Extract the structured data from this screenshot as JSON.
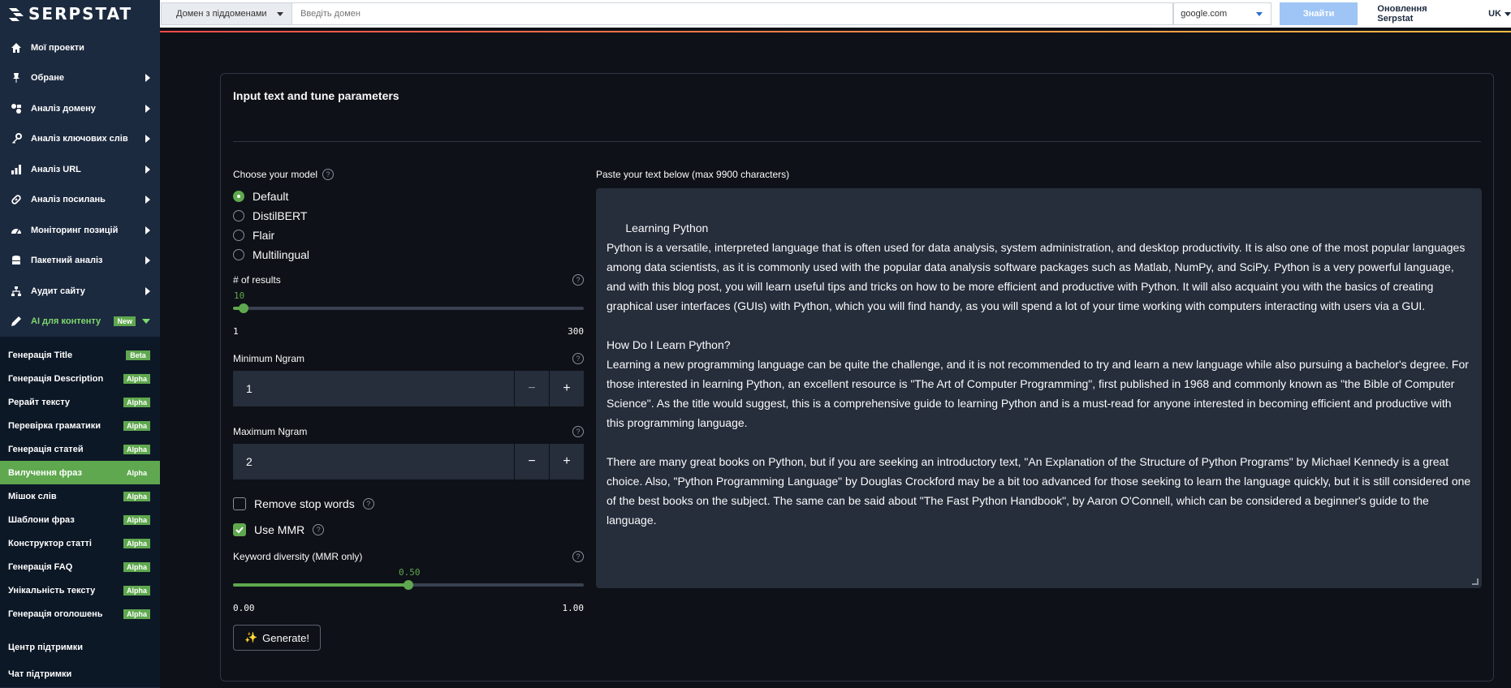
{
  "brand": {
    "logo_text": "SERPSTAT"
  },
  "topbar": {
    "domain_select": "Домен з піддоменами",
    "domain_placeholder": "Введіть домен",
    "database": "google.com",
    "find_button": "Знайти",
    "updates_link": "Оновлення Serpstat",
    "language": "UK"
  },
  "sidebar": {
    "items": [
      {
        "label": "Мої проекти",
        "icon": "home-icon"
      },
      {
        "label": "Обране",
        "icon": "pin-icon"
      },
      {
        "label": "Аналіз домену",
        "icon": "domain-icon"
      },
      {
        "label": "Аналіз ключових слів",
        "icon": "key-icon"
      },
      {
        "label": "Аналіз URL",
        "icon": "bar-chart-icon"
      },
      {
        "label": "Аналіз посилань",
        "icon": "link-icon"
      },
      {
        "label": "Моніторинг позицій",
        "icon": "gauge-icon"
      },
      {
        "label": "Пакетний аналіз",
        "icon": "database-icon"
      },
      {
        "label": "Аудит сайту",
        "icon": "sitemap-icon"
      }
    ],
    "ai_item": {
      "label": "AI для контенту",
      "badge": "New",
      "icon": "pencil-icon"
    },
    "subitems": [
      {
        "label": "Генерація Title",
        "badge": "Beta"
      },
      {
        "label": "Генерація Description",
        "badge": "Alpha"
      },
      {
        "label": "Рерайт тексту",
        "badge": "Alpha"
      },
      {
        "label": "Перевірка граматики",
        "badge": "Alpha"
      },
      {
        "label": "Генерація статей",
        "badge": "Alpha"
      },
      {
        "label": "Вилучення фраз",
        "badge": "Alpha"
      },
      {
        "label": "Мішок слів",
        "badge": "Alpha"
      },
      {
        "label": "Шаблони фраз",
        "badge": "Alpha"
      },
      {
        "label": "Конструктор статті",
        "badge": "Alpha"
      },
      {
        "label": "Генерація FAQ",
        "badge": "Alpha"
      },
      {
        "label": "Унікальність тексту",
        "badge": "Alpha"
      },
      {
        "label": "Генерація оголошень",
        "badge": "Alpha"
      }
    ],
    "active_subitem": 5,
    "support": [
      "Центр підтримки",
      "Чат підтримки"
    ]
  },
  "main": {
    "title": "Input text and tune parameters",
    "model": {
      "label": "Choose your model",
      "options": [
        "Default",
        "DistilBERT",
        "Flair",
        "Multilingual"
      ],
      "selected": 0
    },
    "results": {
      "label": "# of results",
      "value": "10",
      "value_num": 10,
      "min": "1",
      "max": "300",
      "min_num": 1,
      "max_num": 300
    },
    "min_ngram": {
      "label": "Minimum Ngram",
      "value": "1"
    },
    "max_ngram": {
      "label": "Maximum Ngram",
      "value": "2"
    },
    "stepper_minus": "−",
    "stepper_plus": "+",
    "stop_words": {
      "label": "Remove stop words",
      "checked": false
    },
    "mmr": {
      "label": "Use MMR",
      "checked": true
    },
    "diversity": {
      "label": "Keyword diversity (MMR only)",
      "value": "0.50",
      "value_num": 0.5,
      "min": "0.00",
      "max": "1.00",
      "min_num": 0,
      "max_num": 1
    },
    "generate_button": "Generate!",
    "generate_emoji": "✨",
    "text_label": "Paste your text below (max 9900 characters)",
    "text_value": "Learning Python\nPython is a versatile, interpreted language that is often used for data analysis, system administration, and desktop productivity. It is also one of the most popular languages among data scientists, as it is commonly used with the popular data analysis software packages such as Matlab, NumPy, and SciPy. Python is a very powerful language, and with this blog post, you will learn useful tips and tricks on how to be more efficient and productive with Python. It will also acquaint you with the basics of creating graphical user interfaces (GUIs) with Python, which you will find handy, as you will spend a lot of your time working with computers interacting with users via a GUI.\n\nHow Do I Learn Python?\nLearning a new programming language can be quite the challenge, and it is not recommended to try and learn a new language while also pursuing a bachelor's degree. For those interested in learning Python, an excellent resource is \"The Art of Computer Programming\", first published in 1968 and commonly known as \"the Bible of Computer Science\". As the title would suggest, this is a comprehensive guide to learning Python and is a must-read for anyone interested in becoming efficient and productive with this programming language.\n\nThere are many great books on Python, but if you are seeking an introductory text, \"An Explanation of the Structure of Python Programs\" by Michael Kennedy is a great choice. Also, \"Python Programming Language\" by Douglas Crockford may be a bit too advanced for those seeking to learn the language quickly, but it is still considered one of the best books on the subject. The same can be said about \"The Fast Python Handbook\", by Aaron O'Connell, which can be considered a beginner's guide to the language."
  },
  "colors": {
    "accent": "#5fa84f",
    "sidebar": "#1c2a3f",
    "background": "#0e1117",
    "input": "#262d3b"
  }
}
